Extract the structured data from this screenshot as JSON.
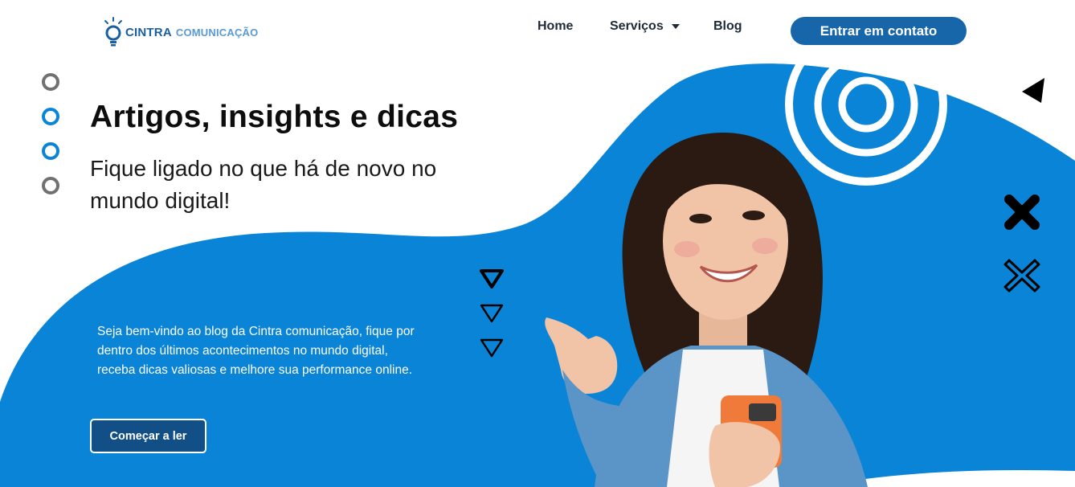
{
  "brand": {
    "name_strong": "CINTRA",
    "name_light": "COMUNICAÇÃO",
    "icon": "lightbulb-icon"
  },
  "nav": {
    "home": "Home",
    "services": "Serviços",
    "blog": "Blog",
    "cta": "Entrar em contato"
  },
  "hero": {
    "title": "Artigos, insights e dicas",
    "subtitle": "Fique ligado no que há de novo no mundo digital!",
    "intro": "Seja bem-vindo ao blog da Cintra comunicação, fique por dentro dos últimos acontecimentos no mundo digital, receba dicas valiosas e melhore sua performance online.",
    "button": "Começar a ler"
  },
  "colors": {
    "hero_blue": "#0a84d6",
    "brand_blue": "#1766aa",
    "dark_blue_button": "#114f86",
    "dot_gray": "#707070",
    "dot_blue": "#0a84d6"
  }
}
